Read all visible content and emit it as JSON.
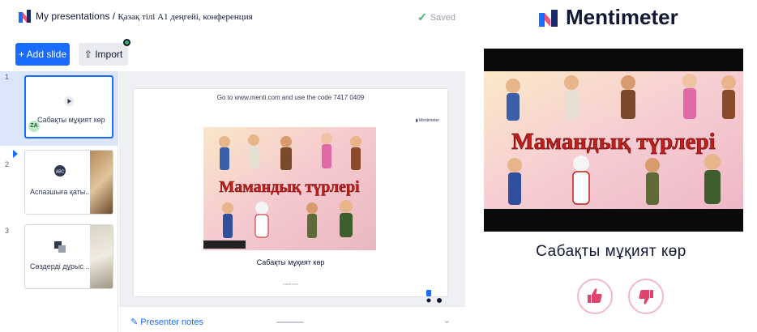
{
  "editor": {
    "breadcrumb_root": "My presentations",
    "breadcrumb_sep": " / ",
    "presentation_title": "Қазақ тілі А1 деңгейі, конференция",
    "saved_label": "Saved",
    "add_slide_label": "+ Add slide",
    "import_label": "Import",
    "slides": [
      {
        "number": "1",
        "label": "Сабақты мұқият көр",
        "icon": "play-icon",
        "avatar": "ZA"
      },
      {
        "number": "2",
        "label": "Аспазшыға қаты...",
        "icon": "abc-icon"
      },
      {
        "number": "3",
        "label": "Сөздерді дұрыс ...",
        "icon": "shapes-icon"
      }
    ],
    "canvas": {
      "join_instruction": "Go to www.menti.com and use the code 7417 0409",
      "brand_mark": "Mentimeter",
      "slide_heading": "Сабақты мұқият көр",
      "image_title": "Мамандық түрлері",
      "footer": "menti.com"
    },
    "presenter_notes_label": "Presenter notes"
  },
  "audience": {
    "brand": "Mentimeter",
    "image_title": "Мамандық түрлері",
    "heading": "Сабақты мұқият көр",
    "reactions": [
      "thumbs-up-icon",
      "thumbs-down-icon"
    ]
  },
  "colors": {
    "accent": "#196cff",
    "saved_check": "#3bb26b",
    "reaction_pink": "#e0436b",
    "title_red": "#c0201d"
  }
}
